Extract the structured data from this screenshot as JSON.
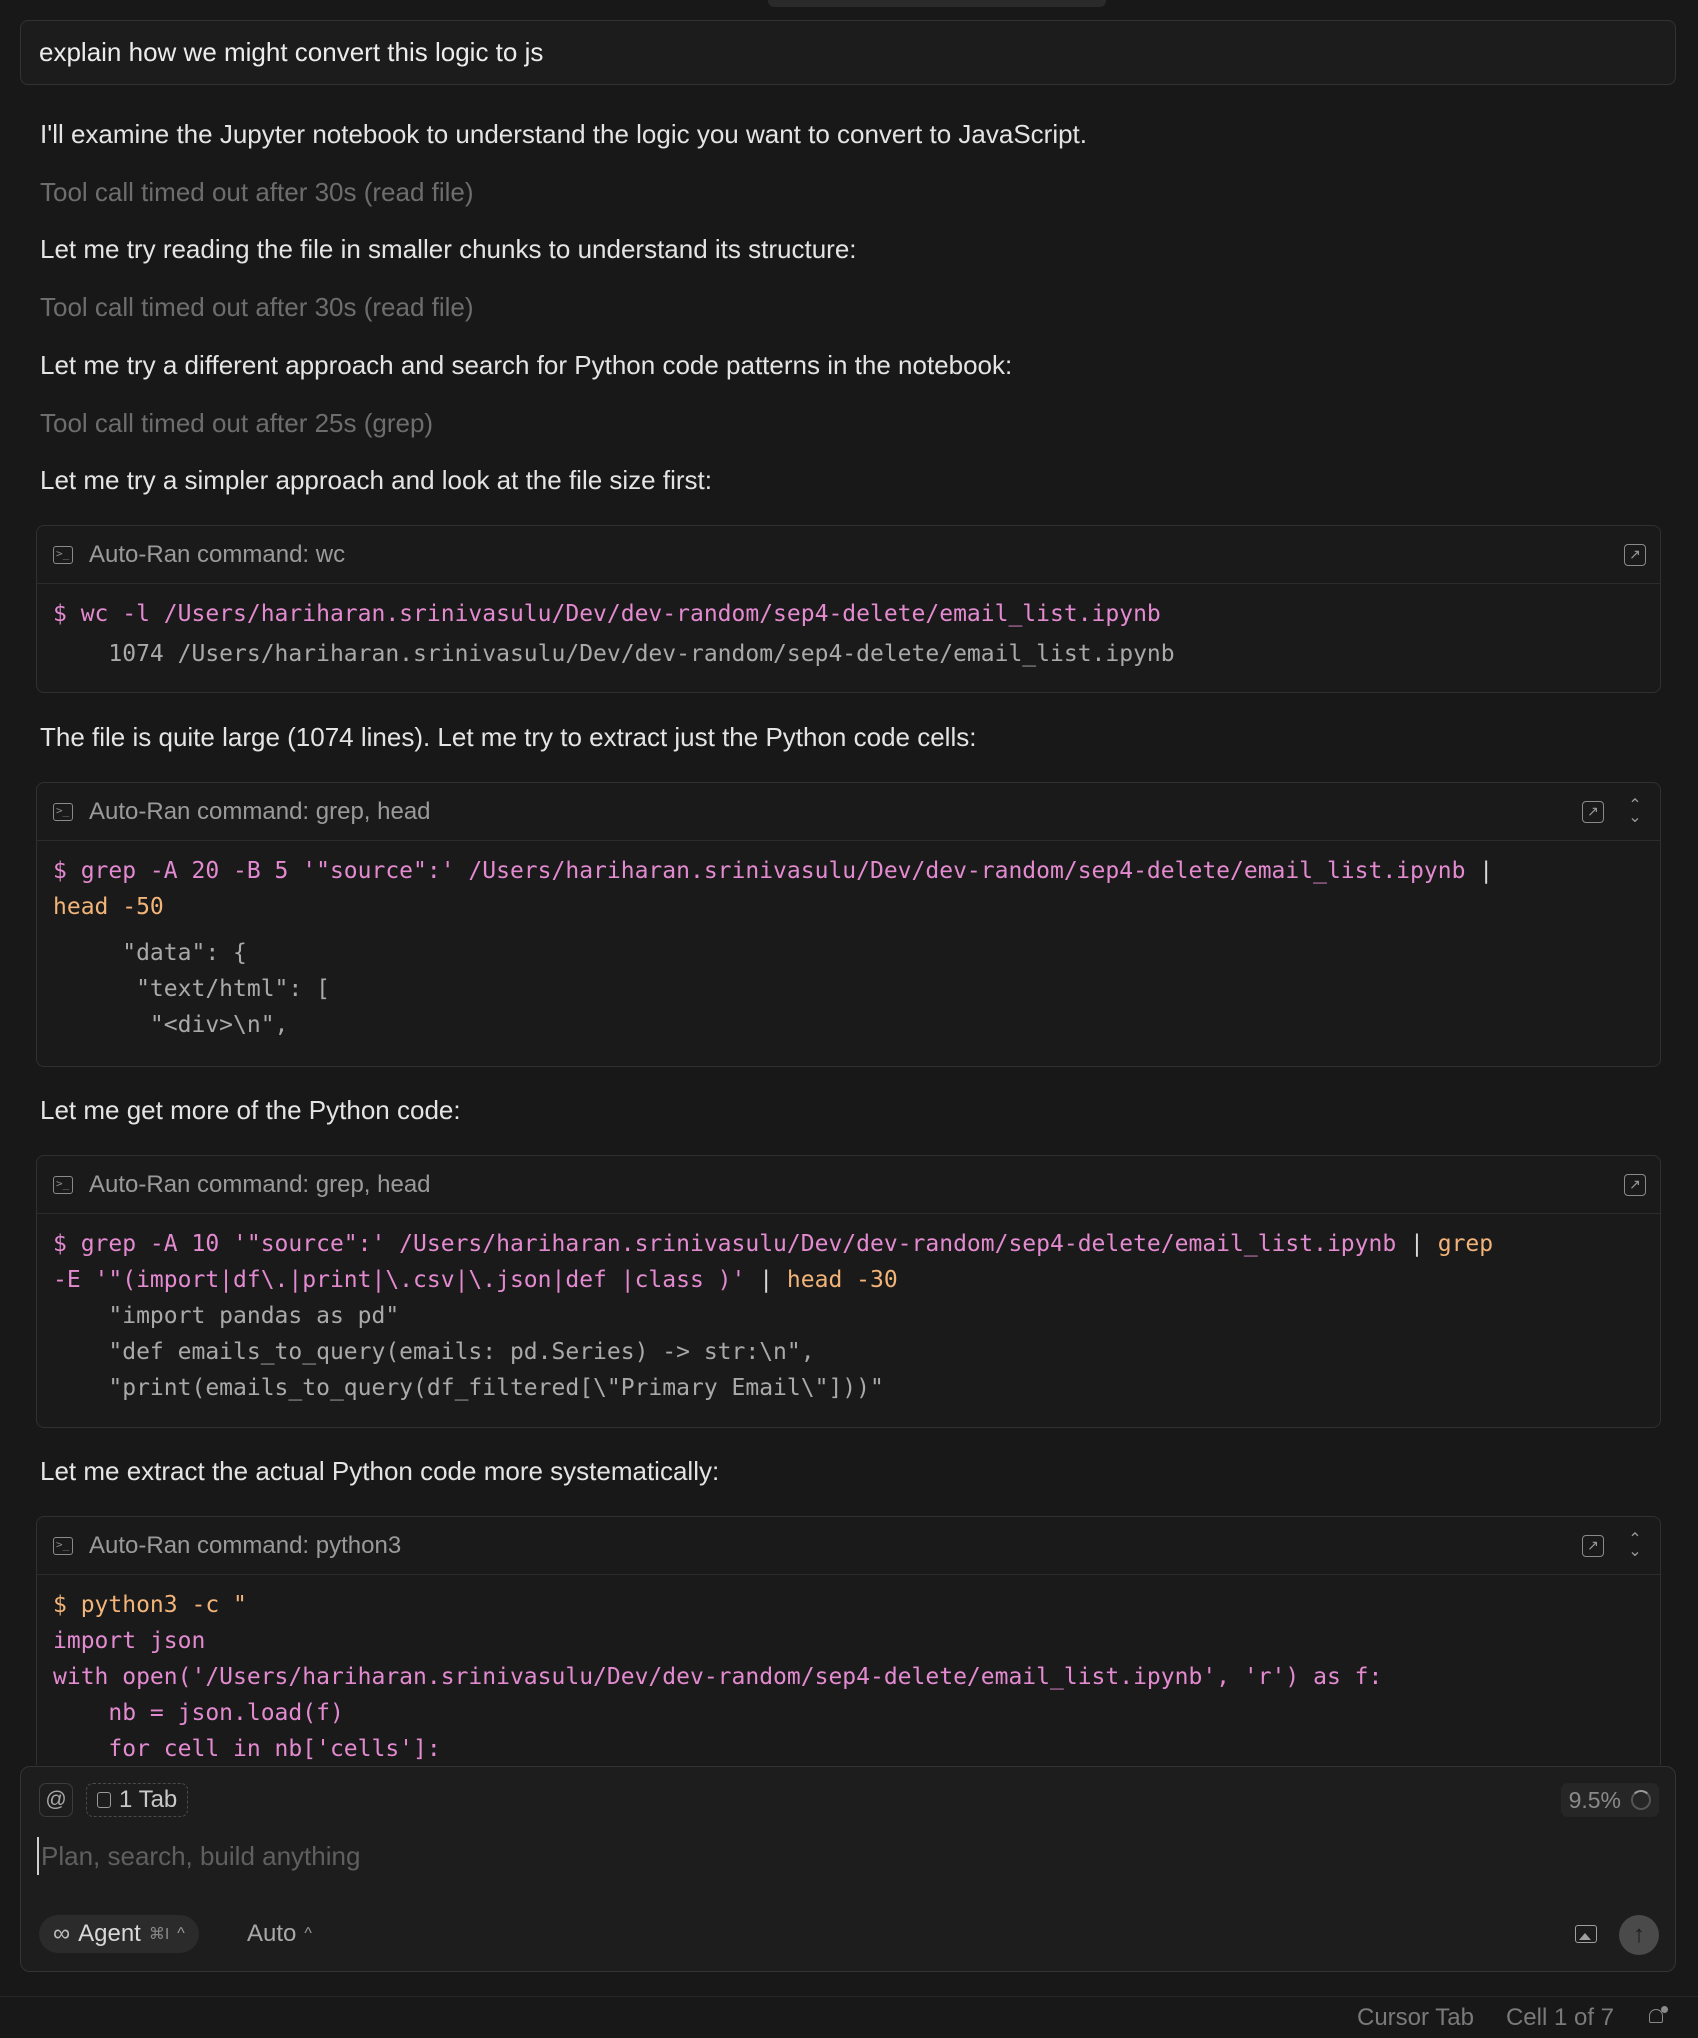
{
  "user_message": "explain how we might convert this logic to js",
  "messages": [
    {
      "text": "I'll examine the Jupyter notebook to understand the logic you want to convert to JavaScript.",
      "dim": false
    },
    {
      "text": "Tool call timed out after 30s (read file)",
      "dim": true
    },
    {
      "text": "Let me try reading the file in smaller chunks to understand its structure:",
      "dim": false
    },
    {
      "text": "Tool call timed out after 30s (read file)",
      "dim": true
    },
    {
      "text": "Let me try a different approach and search for Python code patterns in the notebook:",
      "dim": false
    },
    {
      "text": "Tool call timed out after 25s (grep)",
      "dim": true
    },
    {
      "text": "Let me try a simpler approach and look at the file size first:",
      "dim": false
    },
    {
      "text": "The file is quite large (1074 lines). Let me try to extract just the Python code cells:",
      "dim": false
    },
    {
      "text": "Let me get more of the Python code:",
      "dim": false
    },
    {
      "text": "Let me extract the actual Python code more systematically:",
      "dim": false
    }
  ],
  "commands": [
    {
      "title": "Auto-Ran command: wc",
      "cmd1_a": "$ wc -l /Users/hariharan.srinivasulu/Dev/dev-random/sep4-delete/email_list.ipynb",
      "output": [
        "    1074 /Users/hariharan.srinivasulu/Dev/dev-random/sep4-delete/email_list.ipynb"
      ]
    },
    {
      "title": "Auto-Ran command: grep, head",
      "cmd1_a": "$ grep -A 20 -B 5 '\"source\":' /Users/hariharan.srinivasulu/Dev/dev-random/sep4-delete/email_list.ipynb ",
      "cmd1_pipe": "|",
      "cmd2_a": "head -50",
      "output": [
        "     \"data\": {",
        "      \"text/html\": [",
        "       \"<div>\\n\","
      ]
    },
    {
      "title": "Auto-Ran command: grep, head",
      "cmd1_a": "$ grep -A 10 '\"source\":' /Users/hariharan.srinivasulu/Dev/dev-random/sep4-delete/email_list.ipynb ",
      "cmd1_pipe": "|",
      "cmd1_b": " grep",
      "cmd2_a": "-E '\"(import|df\\.|print|\\.csv|\\.json|def |class )' ",
      "cmd2_pipe": "|",
      "cmd2_b": " head -30",
      "output": [
        "    \"import pandas as pd\"",
        "    \"def emails_to_query(emails: pd.Series) -> str:\\n\",",
        "    \"print(emails_to_query(df_filtered[\\\"Primary Email\\\"]))\""
      ]
    },
    {
      "title": "Auto-Ran command: python3",
      "lines": [
        "$ python3 -c \"",
        "import json",
        "with open('/Users/hariharan.srinivasulu/Dev/dev-random/sep4-delete/email_list.ipynb', 'r') as f:",
        "    nb = json.load(f)",
        "    for cell in nb['cells']:"
      ]
    }
  ],
  "composer": {
    "at_label": "@",
    "tab_chip": "1 Tab",
    "context_pct": "9.5%",
    "placeholder": "Plan, search, build anything",
    "agent_label": "Agent",
    "agent_shortcut": "⌘I",
    "model_label": "Auto"
  },
  "status_bar": {
    "cursor_tab": "Cursor Tab",
    "cell_info": "Cell 1 of 7"
  }
}
